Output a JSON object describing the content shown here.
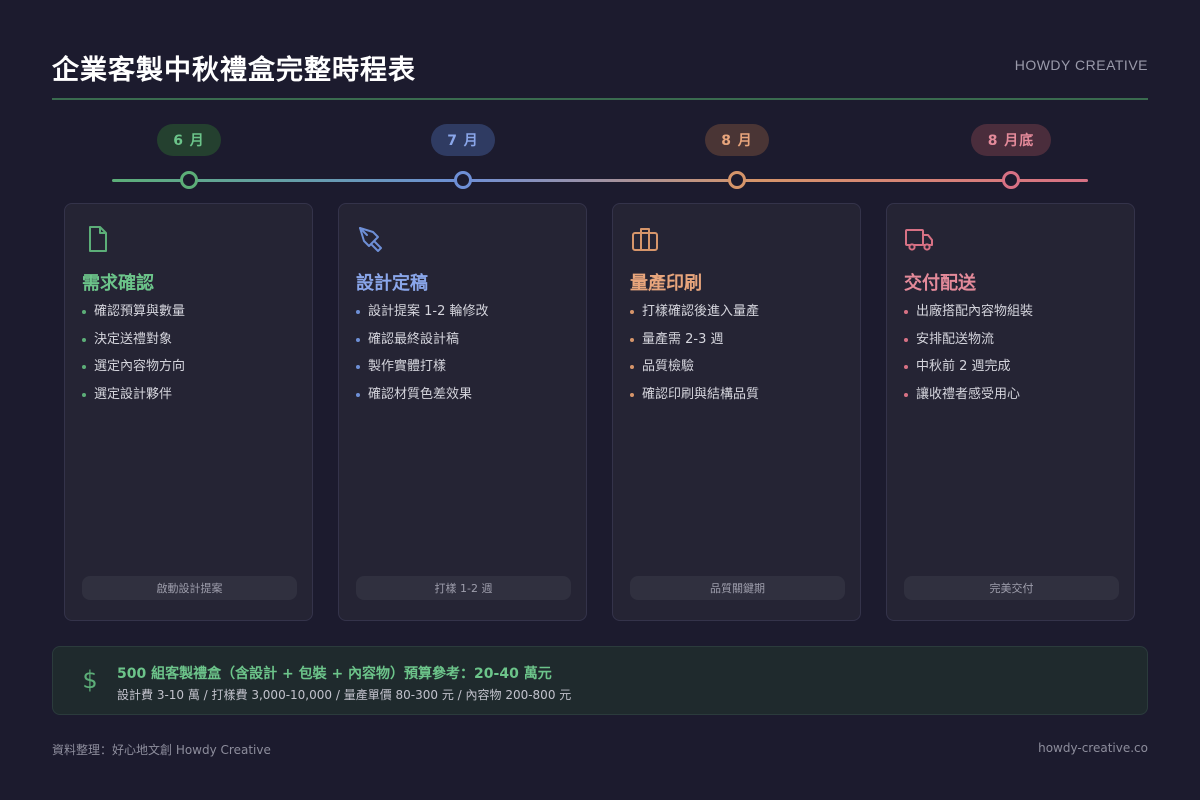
{
  "header": {
    "title": "企業客製中秋禮盒完整時程表",
    "brand": "HOWDY CREATIVE"
  },
  "colors": {
    "green": "#5cae78",
    "blue": "#6e8fd6",
    "orange": "#d6956a",
    "pink": "#d77184",
    "background": "#1c1b2e",
    "card": "#252434"
  },
  "timeline": {
    "milestones": [
      {
        "label": "6 月"
      },
      {
        "label": "7 月"
      },
      {
        "label": "8 月"
      },
      {
        "label": "8 月底"
      }
    ]
  },
  "phases": [
    {
      "icon": "document-icon",
      "title": "需求確認",
      "items": [
        "確認預算與數量",
        "決定送禮對象",
        "選定內容物方向",
        "選定設計夥伴"
      ],
      "tag": "啟動設計提案"
    },
    {
      "icon": "pen-icon",
      "title": "設計定稿",
      "items": [
        "設計提案 1-2 輪修改",
        "確認最終設計稿",
        "製作實體打樣",
        "確認材質色差效果"
      ],
      "tag": "打樣 1-2 週"
    },
    {
      "icon": "briefcase-icon",
      "title": "量產印刷",
      "items": [
        "打樣確認後進入量產",
        "量產需 2-3 週",
        "品質檢驗",
        "確認印刷與結構品質"
      ],
      "tag": "品質關鍵期"
    },
    {
      "icon": "truck-icon",
      "title": "交付配送",
      "items": [
        "出廠搭配內容物組裝",
        "安排配送物流",
        "中秋前 2 週完成",
        "讓收禮者感受用心"
      ],
      "tag": "完美交付"
    }
  ],
  "budget": {
    "icon": "dollar-icon",
    "symbol": "$",
    "main": "500 組客製禮盒（含設計 + 包裝 + 內容物）預算參考：20-40 萬元",
    "detail": "設計費 3-10 萬 / 打樣費 3,000-10,000 / 量產單價 80-300 元 / 內容物 200-800 元"
  },
  "footer": {
    "source": "資料整理：好心地文創 Howdy Creative",
    "website": "howdy-creative.co"
  }
}
